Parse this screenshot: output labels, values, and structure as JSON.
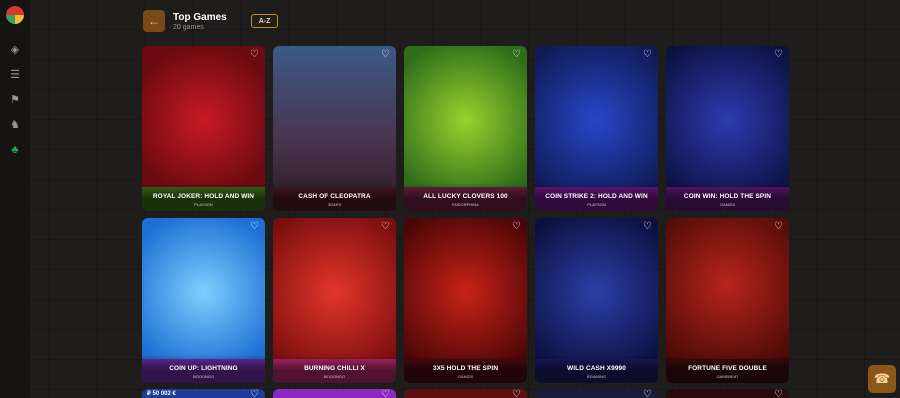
{
  "header": {
    "back_icon": "arrow-left-icon",
    "title": "Top Games",
    "subtitle": "20 games",
    "sort_label": "A-Z"
  },
  "sidebar": {
    "icons": [
      "logo",
      "casino-chip-icon",
      "live-icon",
      "sports-icon",
      "horse-icon",
      "lucky-icon"
    ]
  },
  "games": [
    {
      "name": "ROYAL JOKER: HOLD AND WIN",
      "provider": "PLAYSON"
    },
    {
      "name": "CASH OF CLEOPATRA",
      "provider": "3OAKS"
    },
    {
      "name": "ALL LUCKY CLOVERS 100",
      "provider": "ENDORPHINA"
    },
    {
      "name": "COIN STRIKE 2: HOLD AND WIN",
      "provider": "PLAYSON"
    },
    {
      "name": "COIN WIN: HOLD THE SPIN",
      "provider": "GAMZIX"
    },
    {
      "name": "COIN UP: LIGHTNING",
      "provider": "BOOONGO"
    },
    {
      "name": "BURNING CHILLI X",
      "provider": "BOOONGO"
    },
    {
      "name": "3X5 HOLD THE SPIN",
      "provider": "GAMZIX"
    },
    {
      "name": "WILD CASH X9990",
      "provider": "BGAMING"
    },
    {
      "name": "FORTUNE FIVE DOUBLE",
      "provider": "GAMEBEAT"
    }
  ],
  "next_row": {
    "jackpot_label": "₽ 50 002 €"
  },
  "support": {
    "icon": "headset-icon"
  },
  "colors": {
    "accent": "#7a4a16",
    "accent_border": "#c08a34"
  }
}
